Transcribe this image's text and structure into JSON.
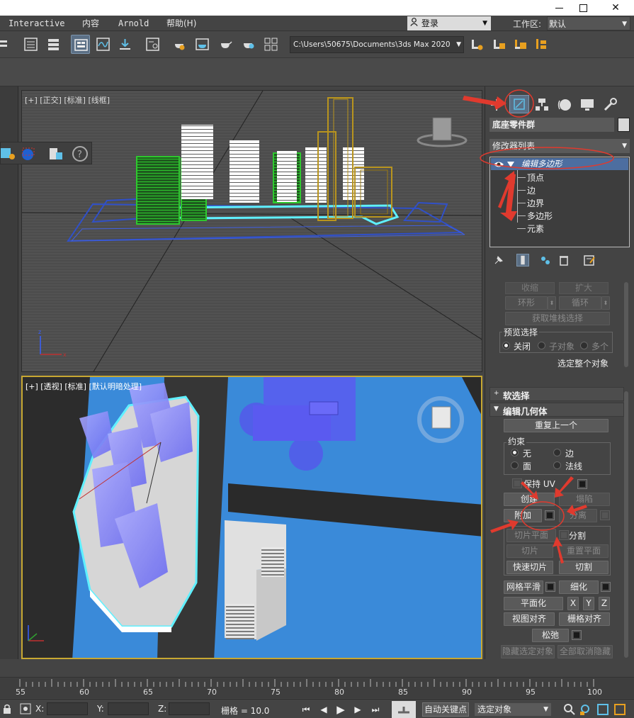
{
  "menubar": {
    "items": [
      "Interactive",
      "内容",
      "Arnold",
      "帮助(H)"
    ],
    "login": "登录",
    "workspace_label": "工作区:",
    "workspace_value": "默认"
  },
  "toolbar": {
    "path": "C:\\Users\\50675\\Documents\\3ds Max 2020"
  },
  "viewports": {
    "top_label": "[+] [正交] [标准] [线框]",
    "persp_label": "[+] [透视] [标准] [默认明暗处理]"
  },
  "command_panel": {
    "object_name": "底座零件群",
    "modifier_list": "修改器列表",
    "stack": {
      "modifier": "编辑多边形",
      "sub_objects": [
        "顶点",
        "边",
        "边界",
        "多边形",
        "元素"
      ]
    },
    "selection": {
      "shrink": "收缩",
      "grow": "扩大",
      "ring": "环形",
      "loop": "循环",
      "get_stack_selection": "获取堆栈选择",
      "preview_label": "预览选择",
      "preview_options": [
        "关闭",
        "子对象",
        "多个"
      ],
      "select_whole": "选定整个对象"
    },
    "soft_selection": "软选择",
    "edit_geometry": {
      "title": "编辑几何体",
      "repeat_last": "重复上一个",
      "constraints_label": "约束",
      "constraints": [
        "无",
        "边",
        "面",
        "法线"
      ],
      "preserve_uv": "保持 UV",
      "create": "创建",
      "collapse": "塌陷",
      "attach": "附加",
      "detach": "分离",
      "slice_plane": "切片平面",
      "split": "分割",
      "slice": "切片",
      "reset_plane": "重置平面",
      "quickslice": "快速切片",
      "cut": "切割",
      "meshsmooth": "网格平滑",
      "tessellate": "细化",
      "make_planar": "平面化",
      "x": "X",
      "y": "Y",
      "z": "Z",
      "view_align": "视图对齐",
      "grid_align": "栅格对齐",
      "relax": "松弛",
      "hide_selected": "隐藏选定对象",
      "unhide_all": "全部取消隐藏"
    }
  },
  "timeline": {
    "ticks": [
      "55",
      "60",
      "65",
      "70",
      "75",
      "80",
      "85",
      "90",
      "95",
      "100"
    ]
  },
  "status": {
    "x_label": "X:",
    "y_label": "Y:",
    "z_label": "Z:",
    "grid": "栅格 = 10.0",
    "auto_key": "自动关键点",
    "selection_set": "选定对象"
  },
  "colors": {
    "viewport_persp_bg": "#3a8ad9",
    "active_border": "#c8a832",
    "stack_highlight": "#4d6ea0",
    "annotation_red": "#e03a2e"
  }
}
